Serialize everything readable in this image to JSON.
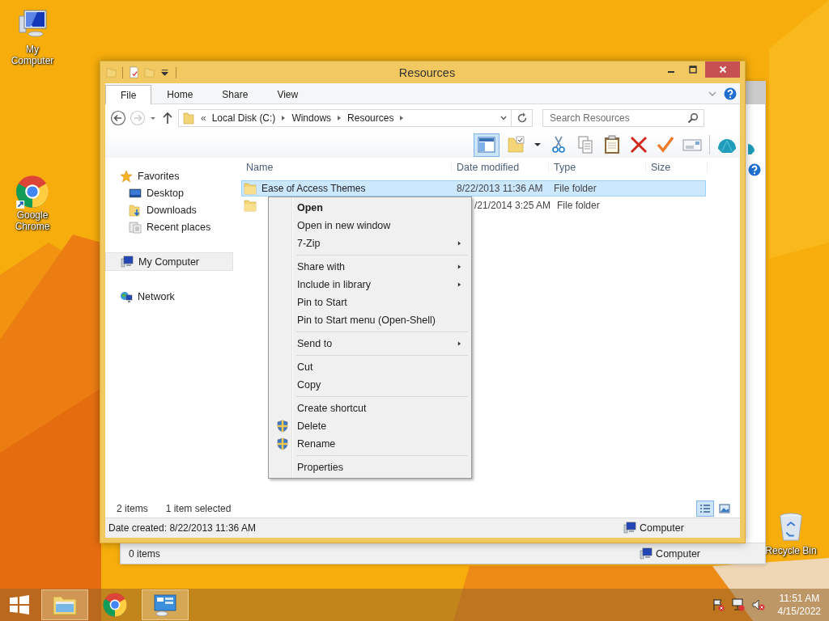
{
  "desktop_icons": [
    {
      "label": "My Computer",
      "kind": "computer"
    },
    {
      "label": "Google Chrome",
      "kind": "chrome"
    },
    {
      "label": "Recycle Bin",
      "kind": "recycle"
    }
  ],
  "back_window": {
    "status_count": "0 items",
    "location": "Computer"
  },
  "window": {
    "title": "Resources",
    "tabs": [
      {
        "label": "File",
        "selected": true
      },
      {
        "label": "Home",
        "selected": false
      },
      {
        "label": "Share",
        "selected": false
      },
      {
        "label": "View",
        "selected": false
      }
    ],
    "address": {
      "overflow": "«",
      "path": [
        "Local Disk (C:)",
        "Windows",
        "Resources"
      ]
    },
    "search": {
      "placeholder": "Search Resources"
    },
    "nav": [
      {
        "label": "Favorites",
        "kind": "favorites",
        "selected": false,
        "children": [
          {
            "label": "Desktop",
            "kind": "desktop",
            "selected": false
          },
          {
            "label": "Downloads",
            "kind": "downloads",
            "selected": false
          },
          {
            "label": "Recent places",
            "kind": "recent",
            "selected": false
          }
        ]
      },
      {
        "label": "My Computer",
        "kind": "computer",
        "selected": true
      },
      {
        "label": "Network",
        "kind": "network",
        "selected": false
      }
    ],
    "columns": [
      "Name",
      "Date modified",
      "Type",
      "Size"
    ],
    "rows": [
      {
        "name": "Ease of Access Themes",
        "date": "8/22/2013 11:36 AM",
        "type": "File folder",
        "selected": true
      },
      {
        "date": "/21/2014 3:25 AM",
        "type": "File folder",
        "selected": false
      }
    ],
    "status": {
      "count": "2 items",
      "selection": "1 item selected"
    },
    "views": [
      {
        "kind": "details",
        "selected": true
      },
      {
        "kind": "thumbnails",
        "selected": false
      }
    ],
    "details_bar": {
      "text": "Date created: 8/22/2013 11:36 AM",
      "location": "Computer"
    }
  },
  "context_menu": [
    [
      {
        "label": "Open",
        "kind": "default"
      },
      {
        "label": "Open in new window",
        "kind": "plain"
      },
      {
        "label": "7-Zip",
        "kind": "submenu"
      }
    ],
    [
      {
        "label": "Share with",
        "kind": "submenu"
      },
      {
        "label": "Include in library",
        "kind": "submenu"
      },
      {
        "label": "Pin to Start",
        "kind": "plain"
      },
      {
        "label": "Pin to Start menu (Open-Shell)",
        "kind": "plain"
      }
    ],
    [
      {
        "label": "Send to",
        "kind": "submenu"
      }
    ],
    [
      {
        "label": "Cut",
        "kind": "plain"
      },
      {
        "label": "Copy",
        "kind": "plain"
      }
    ],
    [
      {
        "label": "Create shortcut",
        "kind": "plain"
      },
      {
        "label": "Delete",
        "kind": "shield"
      },
      {
        "label": "Rename",
        "kind": "shield"
      }
    ],
    [
      {
        "label": "Properties",
        "kind": "plain"
      }
    ]
  ],
  "taskbar": {
    "apps": [
      {
        "kind": "explorer",
        "active": true
      },
      {
        "kind": "chrome",
        "active": false
      },
      {
        "kind": "control-panel",
        "active": true
      }
    ],
    "time": "11:51 AM",
    "date": "4/15/2022"
  }
}
